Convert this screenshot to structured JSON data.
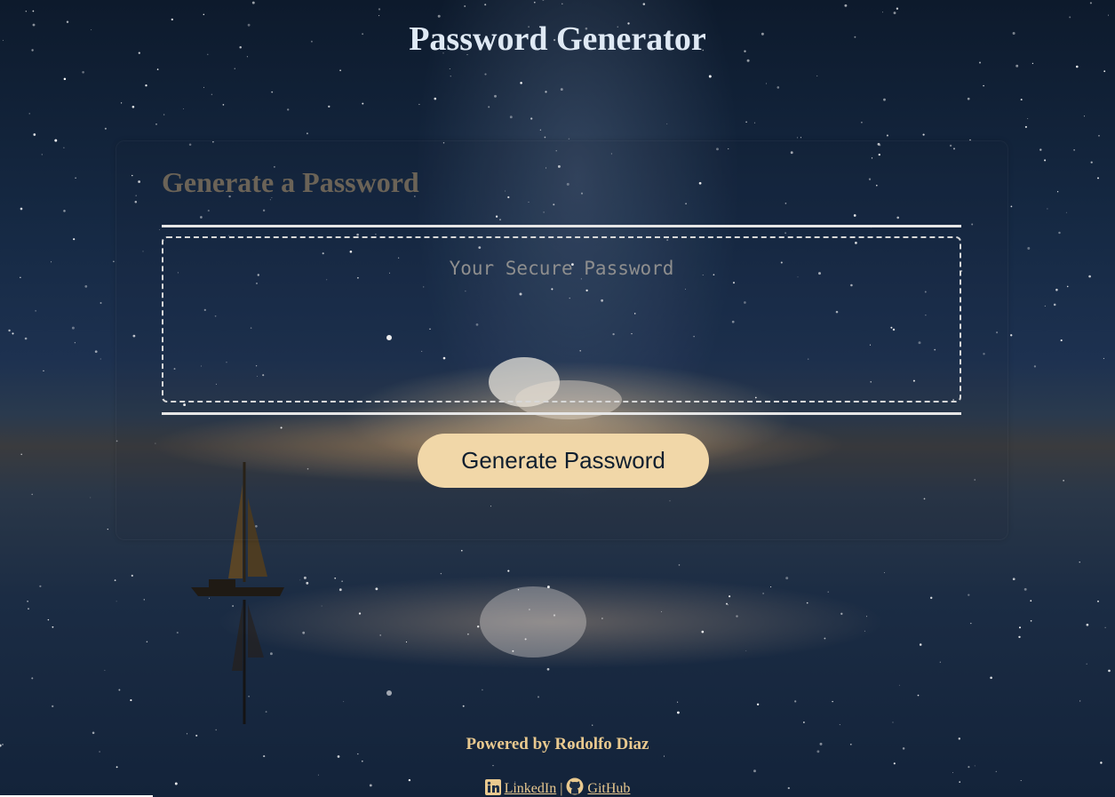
{
  "header": {
    "title": "Password Generator"
  },
  "card": {
    "title": "Generate a Password",
    "password_placeholder": "Your Secure Password",
    "password_value": "",
    "generate_label": "Generate Password"
  },
  "footer": {
    "credit": "Powered by Rodolfo Diaz",
    "links": [
      {
        "label": "LinkedIn",
        "icon": "linkedin-icon"
      },
      {
        "label": "GitHub",
        "icon": "github-icon"
      }
    ],
    "separator": "|"
  },
  "colors": {
    "accent": "#f1d7a8",
    "footer_text": "#e9c98f",
    "title_text": "#dfe9f4",
    "card_title": "#6b6357"
  }
}
